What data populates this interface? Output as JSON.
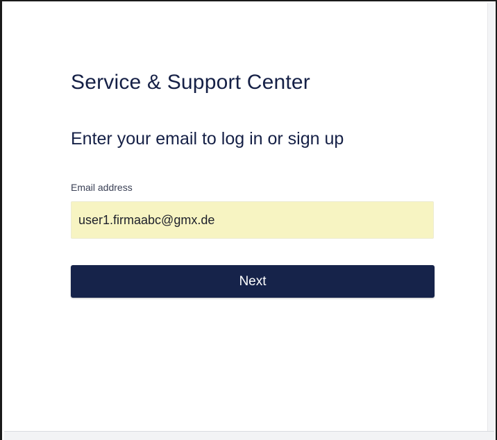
{
  "page": {
    "title": "Service & Support Center",
    "subtitle": "Enter your email to log in or sign up"
  },
  "form": {
    "email_label": "Email address",
    "email_value": "user1.firmaabc@gmx.de",
    "next_label": "Next"
  },
  "colors": {
    "heading": "#152046",
    "button_bg": "#16234a",
    "input_autofill_bg": "#f7f4c2"
  }
}
